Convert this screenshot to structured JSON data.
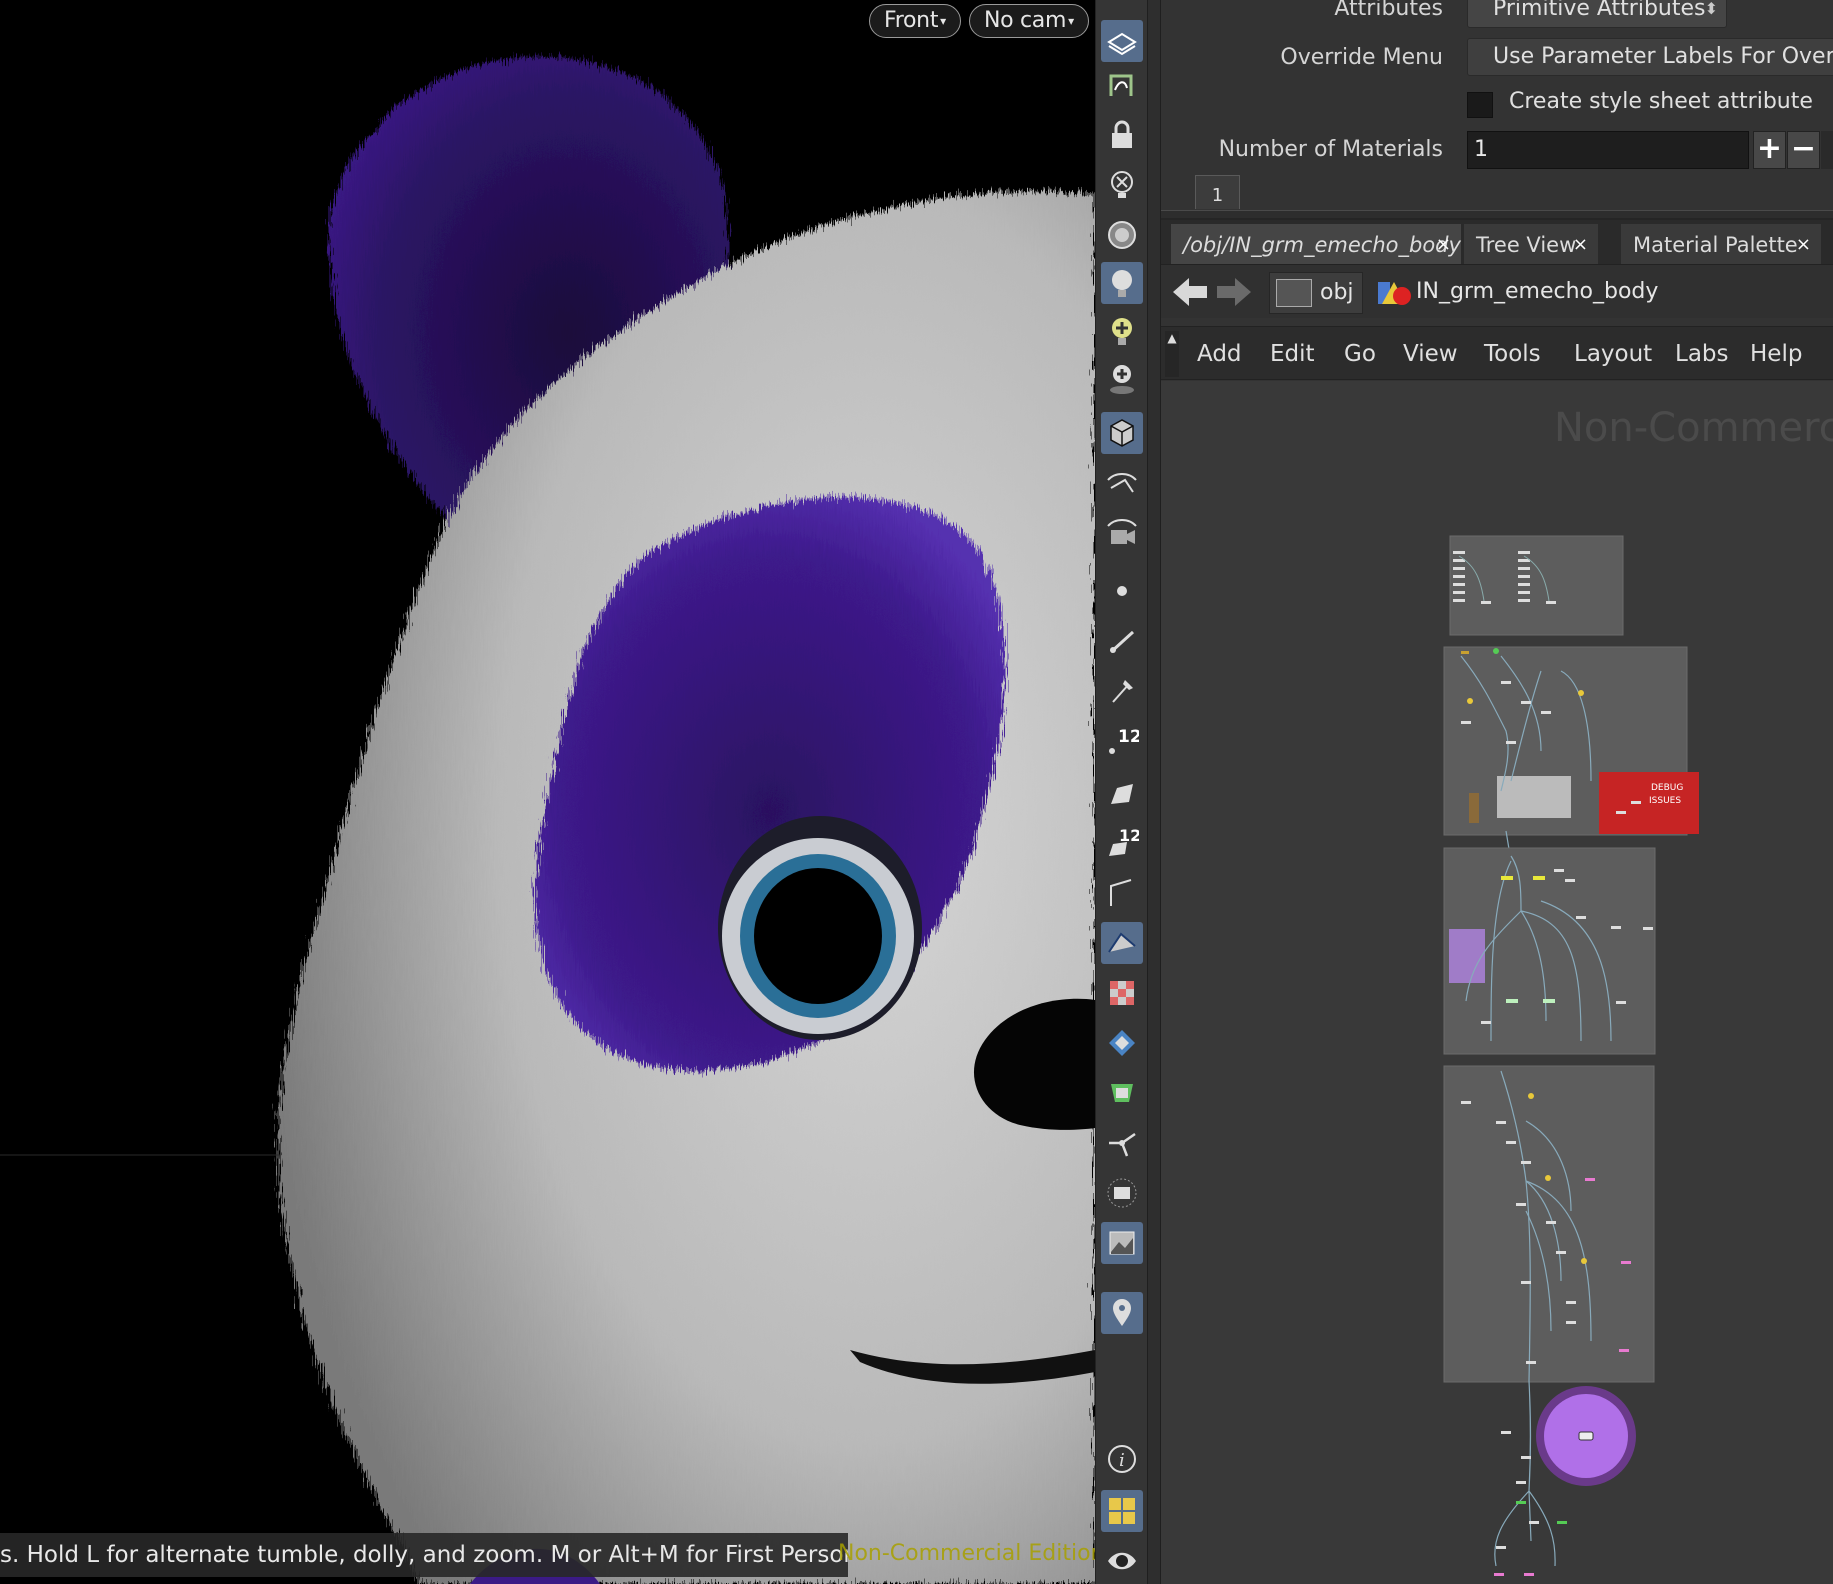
{
  "viewport": {
    "view_label": "Front",
    "cam_label": "No cam",
    "status_message": "s. Hold L for alternate tumble, dolly, and zoom. M or Alt+M for First Person Navigation.",
    "watermark": "Non-Commercial Edition"
  },
  "toolbar": {
    "icons": [
      "display-options-icon",
      "curve-icon",
      "lock-camera-icon",
      "no-light-icon",
      "headlight-icon",
      "normal-light-icon",
      "high-quality-light-icon",
      "shadows-light-icon",
      "wireframe-shading-icon",
      "visualize-icon",
      "visualize-render-icon",
      "point-icon",
      "edge-icon",
      "pin-icon",
      "point-number-icon",
      "primitive-icon",
      "primitive-number-icon",
      "boundary-icon",
      "hull-icon",
      "uv-checker-icon",
      "backface-icon",
      "template-icon",
      "pivot-icon",
      "snap-icon",
      "background-icon",
      "location-pin-icon",
      "info-icon",
      "layout-icon",
      "eye-icon"
    ]
  },
  "parameters": {
    "attributes_label": "Attributes",
    "attributes_value": "Primitive Attributes",
    "override_menu_label": "Override Menu",
    "override_menu_value": "Use Parameter Labels For Override",
    "style_sheet_label": "Create style sheet attribute",
    "style_sheet_checked": false,
    "num_materials_label": "Number of Materials",
    "num_materials_value": "1",
    "plus_label": "+",
    "minus_label": "−",
    "material_tab": "1"
  },
  "tabs": [
    {
      "label": "/obj/IN_grm_emecho_body",
      "active": true
    },
    {
      "label": "Tree View",
      "active": false
    },
    {
      "label": "Material Palette",
      "active": false
    }
  ],
  "tab_close": "×",
  "path": {
    "root": "obj",
    "node": "IN_grm_emecho_body"
  },
  "menu": [
    "Add",
    "Edit",
    "Go",
    "View",
    "Tools",
    "Layout",
    "Labs",
    "Help"
  ],
  "network": {
    "watermark": "Non-Commercia",
    "debug_label_1": "DEBUG",
    "debug_label_2": "ISSUES"
  },
  "colors": {
    "panel_bg": "#333333",
    "network_bg": "#393939",
    "toolbar_active": "#566d8c",
    "fur_purple": "#3f1a8c",
    "debug_red": "#c62424",
    "output_node": "#b070e8"
  }
}
